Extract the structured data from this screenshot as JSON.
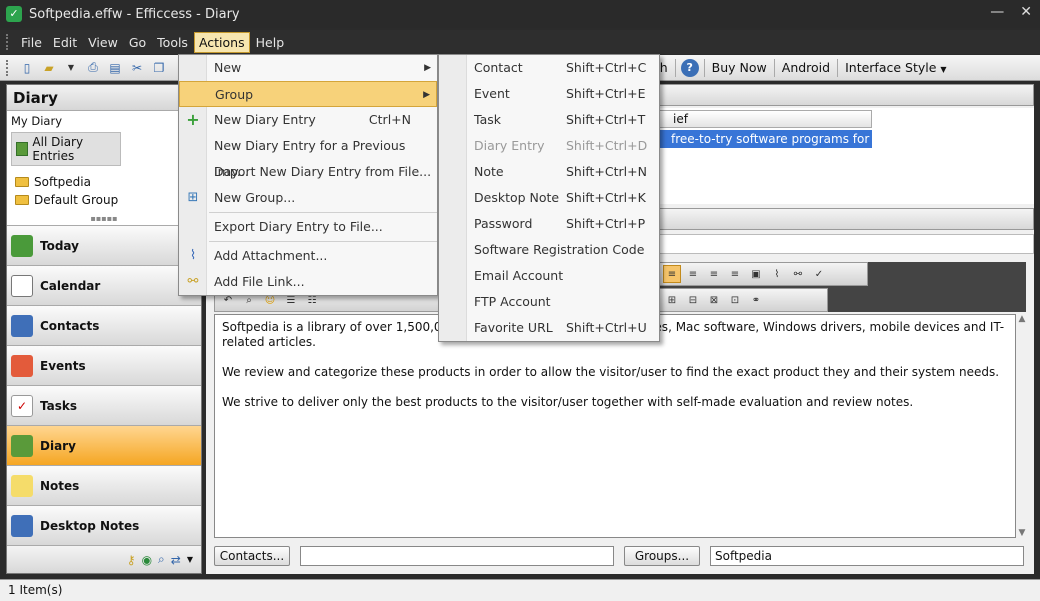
{
  "window": {
    "title": "Softpedia.effw - Efficcess - Diary"
  },
  "menubar": {
    "items": [
      "File",
      "Edit",
      "View",
      "Go",
      "Tools",
      "Actions",
      "Help"
    ]
  },
  "toolbar": {
    "search_label": "rch",
    "buy_now": "Buy Now",
    "android": "Android",
    "interface_style": "Interface Style"
  },
  "left": {
    "header": "Diary",
    "tree_root": "My Diary",
    "all_entries": "All Diary Entries",
    "groups": [
      "Softpedia",
      "Default Group"
    ],
    "nav": [
      "Today",
      "Calendar",
      "Contacts",
      "Events",
      "Tasks",
      "Diary",
      "Notes",
      "Desktop Notes"
    ],
    "active_nav": "Diary"
  },
  "list": {
    "col_header": "ief",
    "selected_row": "free-to-try software programs for Win"
  },
  "editor": {
    "paragraphs": [
      "Softpedia is a library of over 1,500,000 free                                                           ndows and Unix/Linux, games, Mac software, Windows drivers, mobile devices and IT-related articles.",
      "We review and categorize these products in order to allow the visitor/user to find the exact product they and their system needs.",
      "We strive to deliver only the best products to the visitor/user together with self-made evaluation and review notes."
    ]
  },
  "bottom": {
    "contacts_btn": "Contacts...",
    "groups_btn": "Groups...",
    "groups_value": "Softpedia"
  },
  "status": {
    "text": "1 Item(s)"
  },
  "actions_menu": [
    {
      "label": "New",
      "shortcut": "",
      "submenu": true
    },
    {
      "label": "Group",
      "shortcut": "",
      "submenu": true,
      "highlighted": true
    },
    {
      "label": "New Diary Entry",
      "shortcut": "Ctrl+N",
      "icon": "plus-icon"
    },
    {
      "label": "New Diary Entry for a Previous Day...",
      "shortcut": ""
    },
    {
      "label": "Import New Diary Entry from File...",
      "shortcut": ""
    },
    {
      "label": "New Group...",
      "shortcut": "",
      "icon": "group-icon"
    },
    {
      "label": "Export Diary Entry to File...",
      "shortcut": ""
    },
    {
      "label": "Add Attachment...",
      "shortcut": "",
      "icon": "paperclip-icon"
    },
    {
      "label": "Add File Link...",
      "shortcut": "",
      "icon": "file-link-icon"
    }
  ],
  "new_submenu": [
    {
      "label": "Contact",
      "shortcut": "Shift+Ctrl+C"
    },
    {
      "label": "Event",
      "shortcut": "Shift+Ctrl+E"
    },
    {
      "label": "Task",
      "shortcut": "Shift+Ctrl+T"
    },
    {
      "label": "Diary Entry",
      "shortcut": "Shift+Ctrl+D"
    },
    {
      "label": "Note",
      "shortcut": "Shift+Ctrl+N"
    },
    {
      "label": "Desktop Note",
      "shortcut": "Shift+Ctrl+K"
    },
    {
      "label": "Password",
      "shortcut": "Shift+Ctrl+P"
    },
    {
      "label": "Software Registration Code",
      "shortcut": ""
    },
    {
      "label": "Email Account",
      "shortcut": ""
    },
    {
      "label": "FTP Account",
      "shortcut": ""
    },
    {
      "label": "Favorite URL",
      "shortcut": "Shift+Ctrl+U"
    }
  ],
  "colors": {
    "accent": "#f5a623",
    "selection": "#3875d7",
    "menu_highlight": "#f7d27a"
  }
}
